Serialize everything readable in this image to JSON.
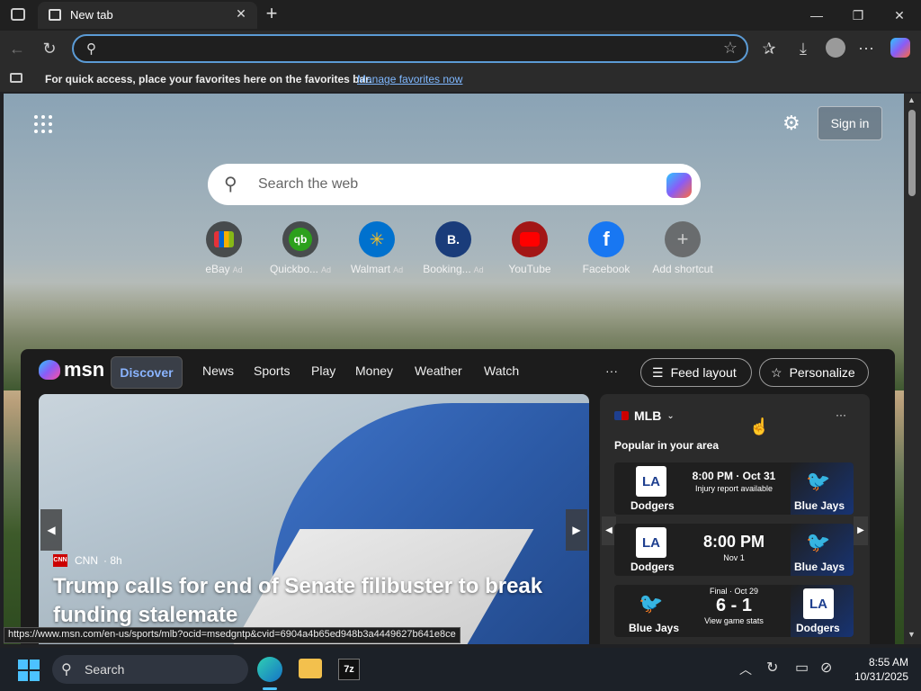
{
  "browser": {
    "tab_title": "New tab",
    "address_value": "",
    "favorites_bar_text": "For quick access, place your favorites here on the favorites bar.",
    "favorites_bar_link": "Manage favorites now"
  },
  "newtab": {
    "sign_in": "Sign in",
    "search_placeholder": "Search the web",
    "shortcuts": [
      {
        "label": "eBay",
        "ad": "Ad",
        "icon": "ebay-icon"
      },
      {
        "label": "Quickbo...",
        "ad": "Ad",
        "icon": "quickbooks-icon"
      },
      {
        "label": "Walmart",
        "ad": "Ad",
        "icon": "walmart-icon"
      },
      {
        "label": "Booking...",
        "ad": "Ad",
        "icon": "booking-icon"
      },
      {
        "label": "YouTube",
        "ad": "",
        "icon": "youtube-icon"
      },
      {
        "label": "Facebook",
        "ad": "",
        "icon": "facebook-icon"
      },
      {
        "label": "Add shortcut",
        "ad": "",
        "icon": "plus-icon"
      }
    ]
  },
  "feed": {
    "logo": "msn",
    "tabs": [
      "Discover",
      "News",
      "Sports",
      "Play",
      "Money",
      "Weather",
      "Watch"
    ],
    "more": "···",
    "feed_layout": "Feed layout",
    "personalize": "Personalize",
    "hero": {
      "source": "CNN",
      "age": "· 8h",
      "headline_line1": "Trump calls for end of Senate filibuster to break",
      "headline_line2": "funding stalemate"
    },
    "mlb": {
      "title": "MLB",
      "subtitle": "Popular in your area",
      "more": "···",
      "games": [
        {
          "left_team": "Dodgers",
          "left_logo": "LA",
          "right_team": "Blue Jays",
          "line1": "8:00 PM · Oct 31",
          "line2": "Injury report available"
        },
        {
          "left_team": "Dodgers",
          "left_logo": "LA",
          "right_team": "Blue Jays",
          "line1": "8:00 PM",
          "line2": "Nov 1"
        },
        {
          "left_team": "Blue Jays",
          "right_logo": "LA",
          "right_team": "Dodgers",
          "line0": "Final · Oct 29",
          "line1": "6 - 1",
          "line2": "View game stats"
        }
      ]
    }
  },
  "status_url": "https://www.msn.com/en-us/sports/mlb?ocid=msedgntp&cvid=6904a4b65ed948b3a4449627b641e8ce",
  "taskbar": {
    "search_label": "Search",
    "time": "8:55 AM",
    "date": "10/31/2025"
  }
}
